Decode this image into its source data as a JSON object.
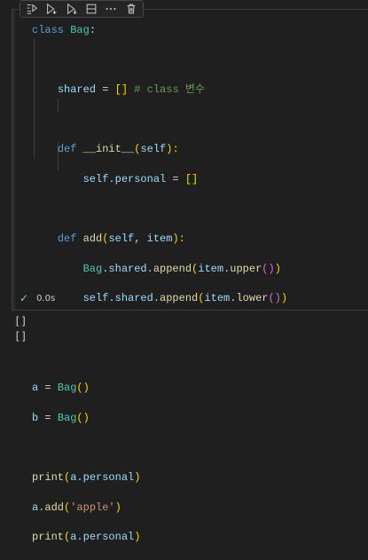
{
  "toolbar": {
    "icons": [
      "run-by-line-icon",
      "execute-above-icon",
      "execute-below-icon",
      "split-cell-icon",
      "more-actions-icon",
      "delete-icon"
    ]
  },
  "code": {
    "l1_kw": "class",
    "l1_name": "Bag",
    "l1_colon": ":",
    "l3_var": "shared",
    "l3_eq": " = ",
    "l3_br": "[]",
    "l3_cmt": " # class 변수",
    "l5_kw": "def",
    "l5_fn": "__init__",
    "l5_p1": "(",
    "l5_self": "self",
    "l5_p2": "):",
    "l6_self": "self",
    "l6_attr": ".personal",
    "l6_eq": " = ",
    "l6_br": "[]",
    "l8_kw": "def",
    "l8_fn": "add",
    "l8_p1": "(",
    "l8_self": "self",
    "l8_comma": ", ",
    "l8_item": "item",
    "l8_p2": "):",
    "l9_cls": "Bag",
    "l9_attr": ".shared.",
    "l9_fn": "append",
    "l9_p1": "(",
    "l9_item": "item",
    "l9_dot": ".",
    "l9_fn2": "upper",
    "l9_p2": "()",
    "l9_p3": ")",
    "l10_self": "self",
    "l10_attr": ".shared.",
    "l10_fn": "append",
    "l10_p1": "(",
    "l10_item": "item",
    "l10_dot": ".",
    "l10_fn2": "lower",
    "l10_p2": "()",
    "l10_p3": ")",
    "l13_var": "a",
    "l13_eq": " = ",
    "l13_cls": "Bag",
    "l13_br": "()",
    "l14_var": "b",
    "l14_eq": " = ",
    "l14_cls": "Bag",
    "l14_br": "()",
    "l16_fn": "print",
    "l16_p1": "(",
    "l16_a": "a",
    "l16_attr": ".personal",
    "l16_p2": ")",
    "l17_a": "a",
    "l17_dot": ".",
    "l17_fn": "add",
    "l17_p1": "(",
    "l17_str": "'apple'",
    "l17_p2": ")",
    "l18_fn": "print",
    "l18_p1": "(",
    "l18_a": "a",
    "l18_attr": ".personal",
    "l18_p2": ")"
  },
  "status": {
    "check": "✓",
    "time": "0.0s"
  },
  "output": {
    "line1": "[]",
    "line2": "[]"
  },
  "colors": {
    "keyword": "#569cd6",
    "class": "#4ec9b0",
    "function": "#dcdcaa",
    "variable": "#9cdcfe",
    "string": "#ce9178",
    "comment": "#6a9955",
    "success": "#89d185"
  }
}
